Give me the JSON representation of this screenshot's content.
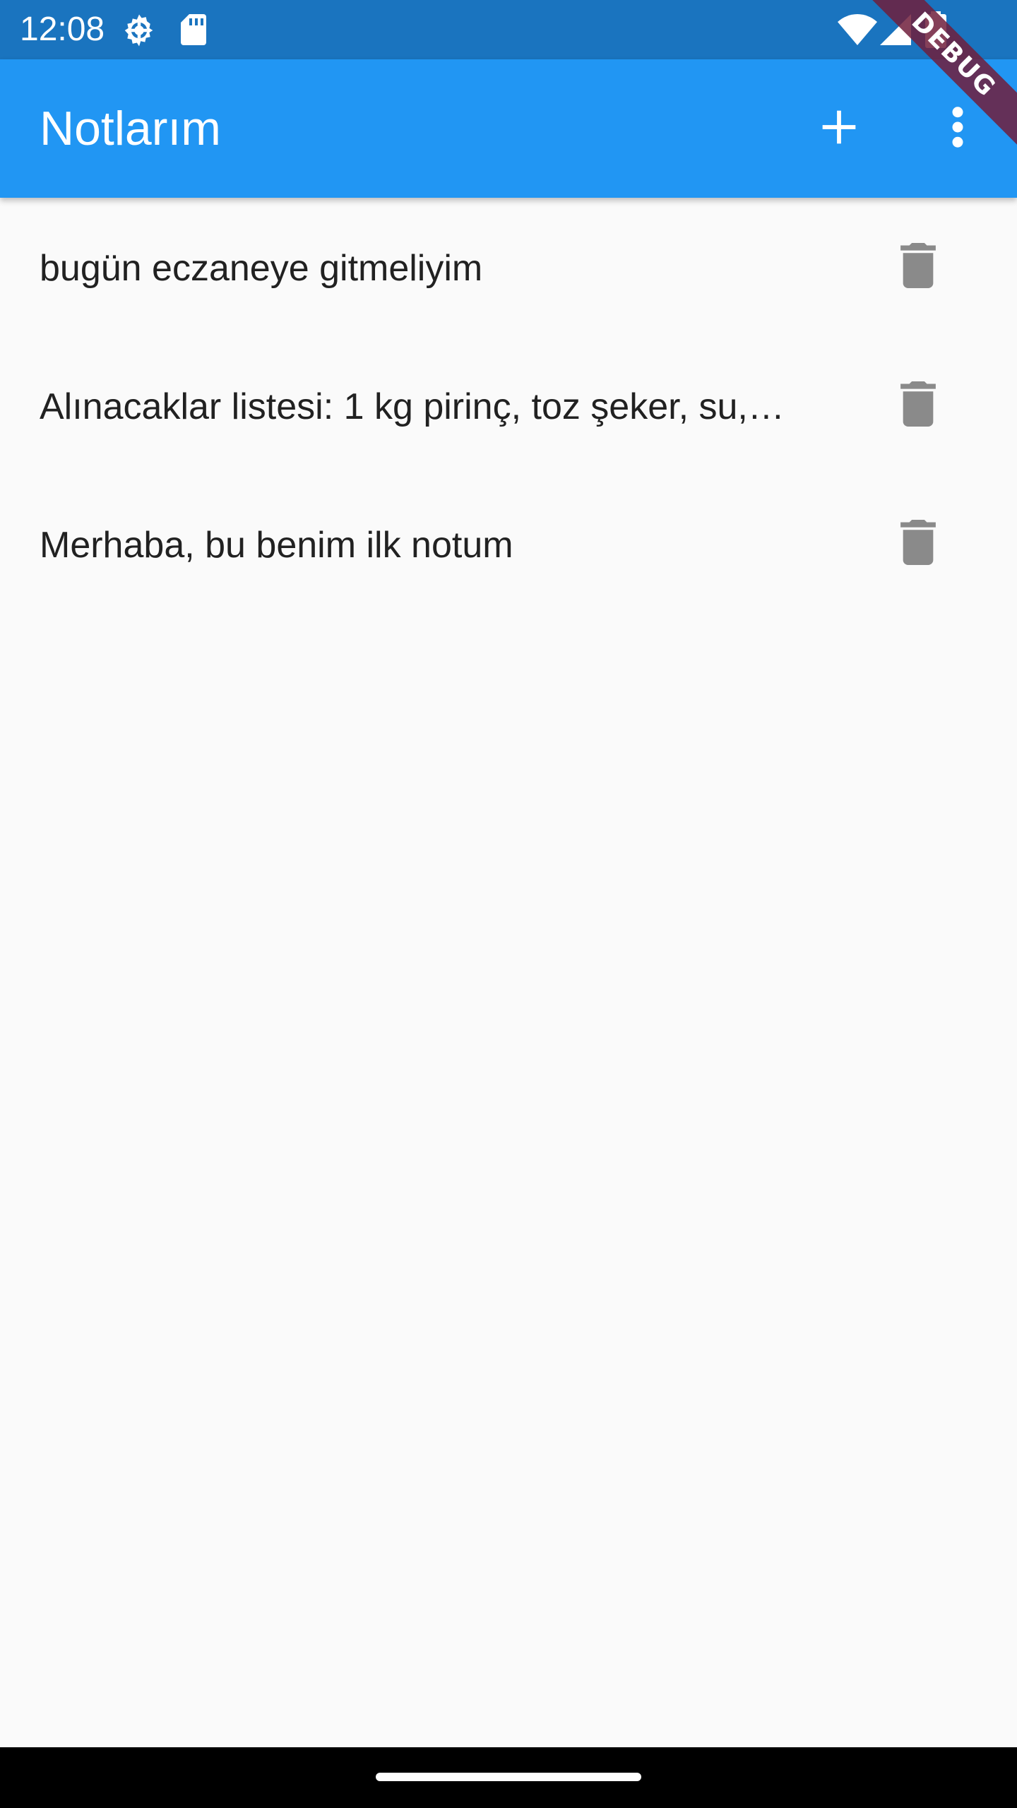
{
  "status_bar": {
    "time": "12:08",
    "icons": [
      "settings-gear-icon",
      "sd-card-icon",
      "wifi-icon",
      "cell-signal-icon",
      "battery-icon"
    ]
  },
  "debug_banner": "DEBUG",
  "app_bar": {
    "title": "Notlarım",
    "actions": [
      "add-icon",
      "more-vert-icon"
    ],
    "color": "#2196f3"
  },
  "notes": [
    {
      "text": "bugün eczaneye gitmeliyim",
      "action_icon": "delete-icon"
    },
    {
      "text": "Alınacaklar listesi: 1 kg pirinç, toz şeker, su,…",
      "action_icon": "delete-icon"
    },
    {
      "text": "Merhaba, bu benim ilk notum",
      "action_icon": "delete-icon"
    }
  ]
}
